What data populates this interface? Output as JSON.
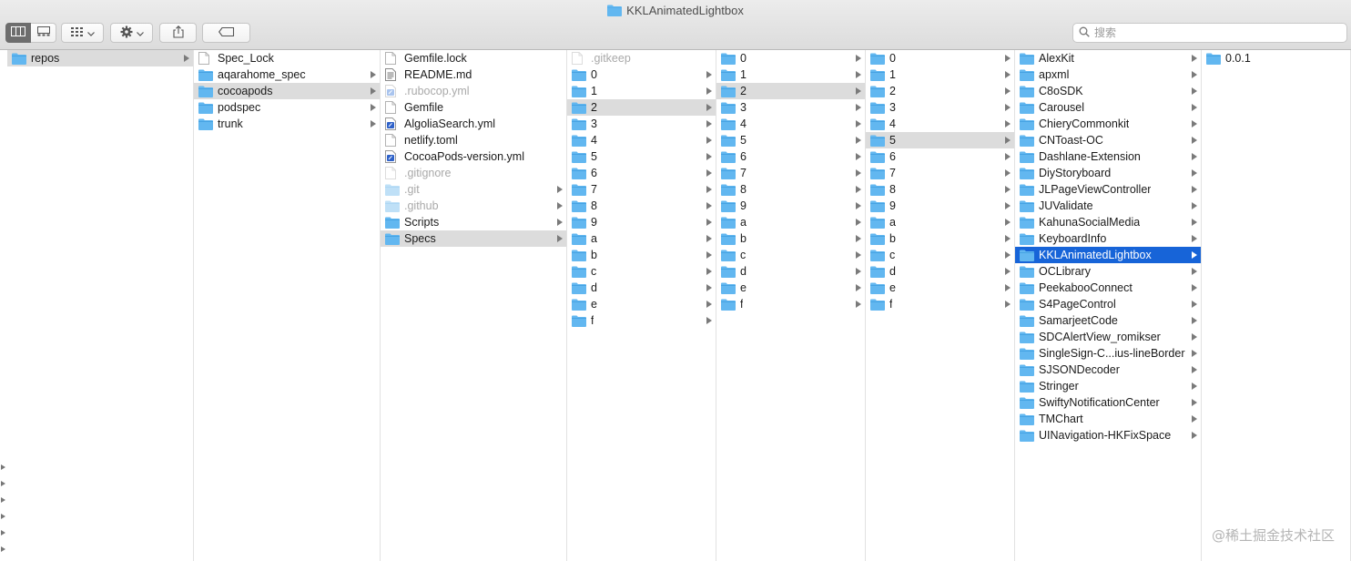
{
  "window": {
    "title": "KKLAnimatedLightbox"
  },
  "search": {
    "placeholder": "搜索"
  },
  "colors": {
    "accent": "#1764d8",
    "folder": "#62b7f0",
    "selected_row": "#dcdcdc"
  },
  "columns": [
    {
      "items": [
        {
          "label": "repos",
          "kind": "folder",
          "arrow": true,
          "state": "sel"
        }
      ]
    },
    {
      "items": [
        {
          "label": "Spec_Lock",
          "kind": "file"
        },
        {
          "label": "aqarahome_spec",
          "kind": "folder",
          "arrow": true
        },
        {
          "label": "cocoapods",
          "kind": "folder",
          "arrow": true,
          "state": "sel"
        },
        {
          "label": "podspec",
          "kind": "folder",
          "arrow": true
        },
        {
          "label": "trunk",
          "kind": "folder",
          "arrow": true
        }
      ]
    },
    {
      "items": [
        {
          "label": "Gemfile.lock",
          "kind": "file"
        },
        {
          "label": "README.md",
          "kind": "doc"
        },
        {
          "label": ".rubocop.yml",
          "kind": "yml",
          "dim": true
        },
        {
          "label": "Gemfile",
          "kind": "file"
        },
        {
          "label": "AlgoliaSearch.yml",
          "kind": "yml"
        },
        {
          "label": "netlify.toml",
          "kind": "file"
        },
        {
          "label": "CocoaPods-version.yml",
          "kind": "yml"
        },
        {
          "label": ".gitignore",
          "kind": "file",
          "dim": true
        },
        {
          "label": ".git",
          "kind": "folder",
          "arrow": true,
          "dim": true
        },
        {
          "label": ".github",
          "kind": "folder",
          "arrow": true,
          "dim": true
        },
        {
          "label": "Scripts",
          "kind": "folder",
          "arrow": true
        },
        {
          "label": "Specs",
          "kind": "folder",
          "arrow": true,
          "state": "sel"
        }
      ]
    },
    {
      "items": [
        {
          "label": ".gitkeep",
          "kind": "file",
          "dim": true
        },
        {
          "label": "0",
          "kind": "folder",
          "arrow": true
        },
        {
          "label": "1",
          "kind": "folder",
          "arrow": true
        },
        {
          "label": "2",
          "kind": "folder",
          "arrow": true,
          "state": "sel"
        },
        {
          "label": "3",
          "kind": "folder",
          "arrow": true
        },
        {
          "label": "4",
          "kind": "folder",
          "arrow": true
        },
        {
          "label": "5",
          "kind": "folder",
          "arrow": true
        },
        {
          "label": "6",
          "kind": "folder",
          "arrow": true
        },
        {
          "label": "7",
          "kind": "folder",
          "arrow": true
        },
        {
          "label": "8",
          "kind": "folder",
          "arrow": true
        },
        {
          "label": "9",
          "kind": "folder",
          "arrow": true
        },
        {
          "label": "a",
          "kind": "folder",
          "arrow": true
        },
        {
          "label": "b",
          "kind": "folder",
          "arrow": true
        },
        {
          "label": "c",
          "kind": "folder",
          "arrow": true
        },
        {
          "label": "d",
          "kind": "folder",
          "arrow": true
        },
        {
          "label": "e",
          "kind": "folder",
          "arrow": true
        },
        {
          "label": "f",
          "kind": "folder",
          "arrow": true
        }
      ]
    },
    {
      "items": [
        {
          "label": "0",
          "kind": "folder",
          "arrow": true
        },
        {
          "label": "1",
          "kind": "folder",
          "arrow": true
        },
        {
          "label": "2",
          "kind": "folder",
          "arrow": true,
          "state": "sel"
        },
        {
          "label": "3",
          "kind": "folder",
          "arrow": true
        },
        {
          "label": "4",
          "kind": "folder",
          "arrow": true
        },
        {
          "label": "5",
          "kind": "folder",
          "arrow": true
        },
        {
          "label": "6",
          "kind": "folder",
          "arrow": true
        },
        {
          "label": "7",
          "kind": "folder",
          "arrow": true
        },
        {
          "label": "8",
          "kind": "folder",
          "arrow": true
        },
        {
          "label": "9",
          "kind": "folder",
          "arrow": true
        },
        {
          "label": "a",
          "kind": "folder",
          "arrow": true
        },
        {
          "label": "b",
          "kind": "folder",
          "arrow": true
        },
        {
          "label": "c",
          "kind": "folder",
          "arrow": true
        },
        {
          "label": "d",
          "kind": "folder",
          "arrow": true
        },
        {
          "label": "e",
          "kind": "folder",
          "arrow": true
        },
        {
          "label": "f",
          "kind": "folder",
          "arrow": true
        }
      ]
    },
    {
      "items": [
        {
          "label": "0",
          "kind": "folder",
          "arrow": true
        },
        {
          "label": "1",
          "kind": "folder",
          "arrow": true
        },
        {
          "label": "2",
          "kind": "folder",
          "arrow": true
        },
        {
          "label": "3",
          "kind": "folder",
          "arrow": true
        },
        {
          "label": "4",
          "kind": "folder",
          "arrow": true
        },
        {
          "label": "5",
          "kind": "folder",
          "arrow": true,
          "state": "sel"
        },
        {
          "label": "6",
          "kind": "folder",
          "arrow": true
        },
        {
          "label": "7",
          "kind": "folder",
          "arrow": true
        },
        {
          "label": "8",
          "kind": "folder",
          "arrow": true
        },
        {
          "label": "9",
          "kind": "folder",
          "arrow": true
        },
        {
          "label": "a",
          "kind": "folder",
          "arrow": true
        },
        {
          "label": "b",
          "kind": "folder",
          "arrow": true
        },
        {
          "label": "c",
          "kind": "folder",
          "arrow": true
        },
        {
          "label": "d",
          "kind": "folder",
          "arrow": true
        },
        {
          "label": "e",
          "kind": "folder",
          "arrow": true
        },
        {
          "label": "f",
          "kind": "folder",
          "arrow": true
        }
      ]
    },
    {
      "items": [
        {
          "label": "AlexKit",
          "kind": "folder",
          "arrow": true
        },
        {
          "label": "apxml",
          "kind": "folder",
          "arrow": true
        },
        {
          "label": "C8oSDK",
          "kind": "folder",
          "arrow": true
        },
        {
          "label": "Carousel",
          "kind": "folder",
          "arrow": true
        },
        {
          "label": "ChieryCommonkit",
          "kind": "folder",
          "arrow": true
        },
        {
          "label": "CNToast-OC",
          "kind": "folder",
          "arrow": true
        },
        {
          "label": "Dashlane-Extension",
          "kind": "folder",
          "arrow": true
        },
        {
          "label": "DiyStoryboard",
          "kind": "folder",
          "arrow": true
        },
        {
          "label": "JLPageViewController",
          "kind": "folder",
          "arrow": true
        },
        {
          "label": "JUValidate",
          "kind": "folder",
          "arrow": true
        },
        {
          "label": "KahunaSocialMedia",
          "kind": "folder",
          "arrow": true
        },
        {
          "label": "KeyboardInfo",
          "kind": "folder",
          "arrow": true
        },
        {
          "label": "KKLAnimatedLightbox",
          "kind": "folder",
          "arrow": true,
          "state": "active"
        },
        {
          "label": "OCLibrary",
          "kind": "folder",
          "arrow": true
        },
        {
          "label": "PeekabooConnect",
          "kind": "folder",
          "arrow": true
        },
        {
          "label": "S4PageControl",
          "kind": "folder",
          "arrow": true
        },
        {
          "label": "SamarjeetCode",
          "kind": "folder",
          "arrow": true
        },
        {
          "label": "SDCAlertView_romikser",
          "kind": "folder",
          "arrow": true
        },
        {
          "label": "SingleSign-C...ius-lineBorder",
          "kind": "folder",
          "arrow": true
        },
        {
          "label": "SJSONDecoder",
          "kind": "folder",
          "arrow": true
        },
        {
          "label": "Stringer",
          "kind": "folder",
          "arrow": true
        },
        {
          "label": "SwiftyNotificationCenter",
          "kind": "folder",
          "arrow": true
        },
        {
          "label": "TMChart",
          "kind": "folder",
          "arrow": true
        },
        {
          "label": "UINavigation-HKFixSpace",
          "kind": "folder",
          "arrow": true
        }
      ]
    },
    {
      "items": [
        {
          "label": "0.0.1",
          "kind": "folder",
          "arrow": false
        }
      ]
    }
  ],
  "watermark": "@稀土掘金技术社区"
}
